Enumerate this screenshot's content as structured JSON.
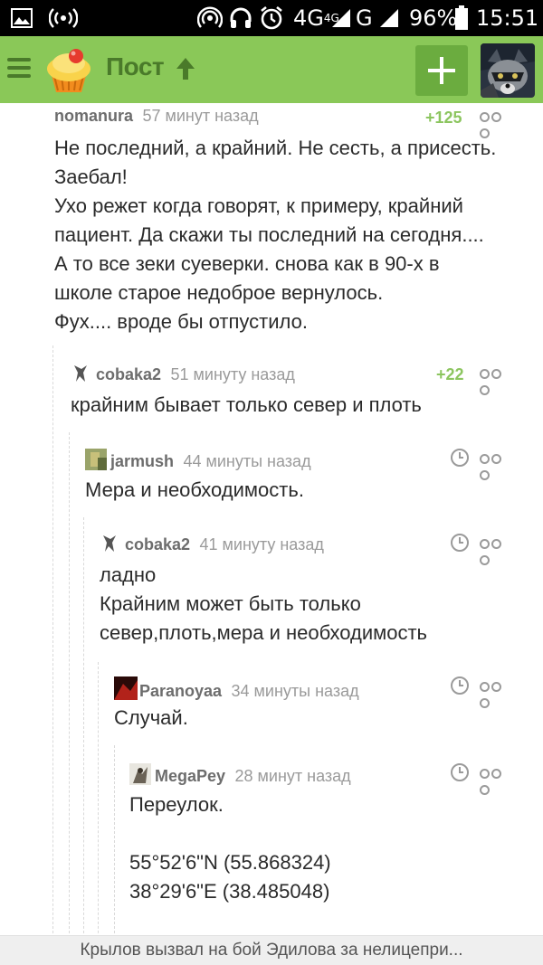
{
  "status_bar": {
    "network": "4G",
    "network_small": "4G",
    "carrier_signal": "G",
    "battery": "96%",
    "time": "15:51",
    "icons": [
      "image-icon",
      "broadcast-icon",
      "hotspot-icon",
      "headphones-icon",
      "alarm-icon",
      "signal-icon",
      "battery-icon"
    ]
  },
  "header": {
    "title": "Пост",
    "icons": [
      "menu-icon",
      "cupcake-logo",
      "arrow-up-icon",
      "plus-icon",
      "raccoon-avatar"
    ]
  },
  "comments": [
    {
      "author": "nomanura",
      "time": "57 минут назад",
      "rating": "+125",
      "lines": [
        "Не последний, а крайний. Не сесть, а присесть.",
        "Заебал!",
        "Ухо режет когда говорят, к примеру, крайний",
        "пациент. Да скажи ты последний на сегодня....",
        "А то все зеки суеверки. снова как в 90-х в",
        "школе старое недоброе вернулось.",
        "Фух.... вроде бы отпустило."
      ]
    },
    {
      "author": "cobaka2",
      "time": "51 минуту назад",
      "rating": "+22",
      "lines": [
        "крайним бывает только север и плоть"
      ]
    },
    {
      "author": "jarmush",
      "time": "44 минуты назад",
      "rating": "",
      "lines": [
        "Мера и необходимость."
      ]
    },
    {
      "author": "cobaka2",
      "time": "41 минуту назад",
      "rating": "",
      "lines": [
        "ладно",
        "Крайним может быть только",
        "север,плоть,мера и необходимость"
      ]
    },
    {
      "author": "Paranoyaa",
      "time": "34 минуты назад",
      "rating": "",
      "lines": [
        "Случай."
      ]
    },
    {
      "author": "MegaPey",
      "time": "28 минут назад",
      "rating": "",
      "lines": [
        "Переулок.",
        "",
        "55°52'6\"N (55.868324)",
        "38°29'6\"E (38.485048)"
      ]
    }
  ],
  "bottom_bar": {
    "text": "Крылов вызвал на бой Эдилова за нелицепри..."
  },
  "colors": {
    "header_bg": "#8ac858",
    "header_dark": "#4a7a2a",
    "rating_green": "#8cc55f",
    "meta_gray": "#9a9a9a"
  }
}
